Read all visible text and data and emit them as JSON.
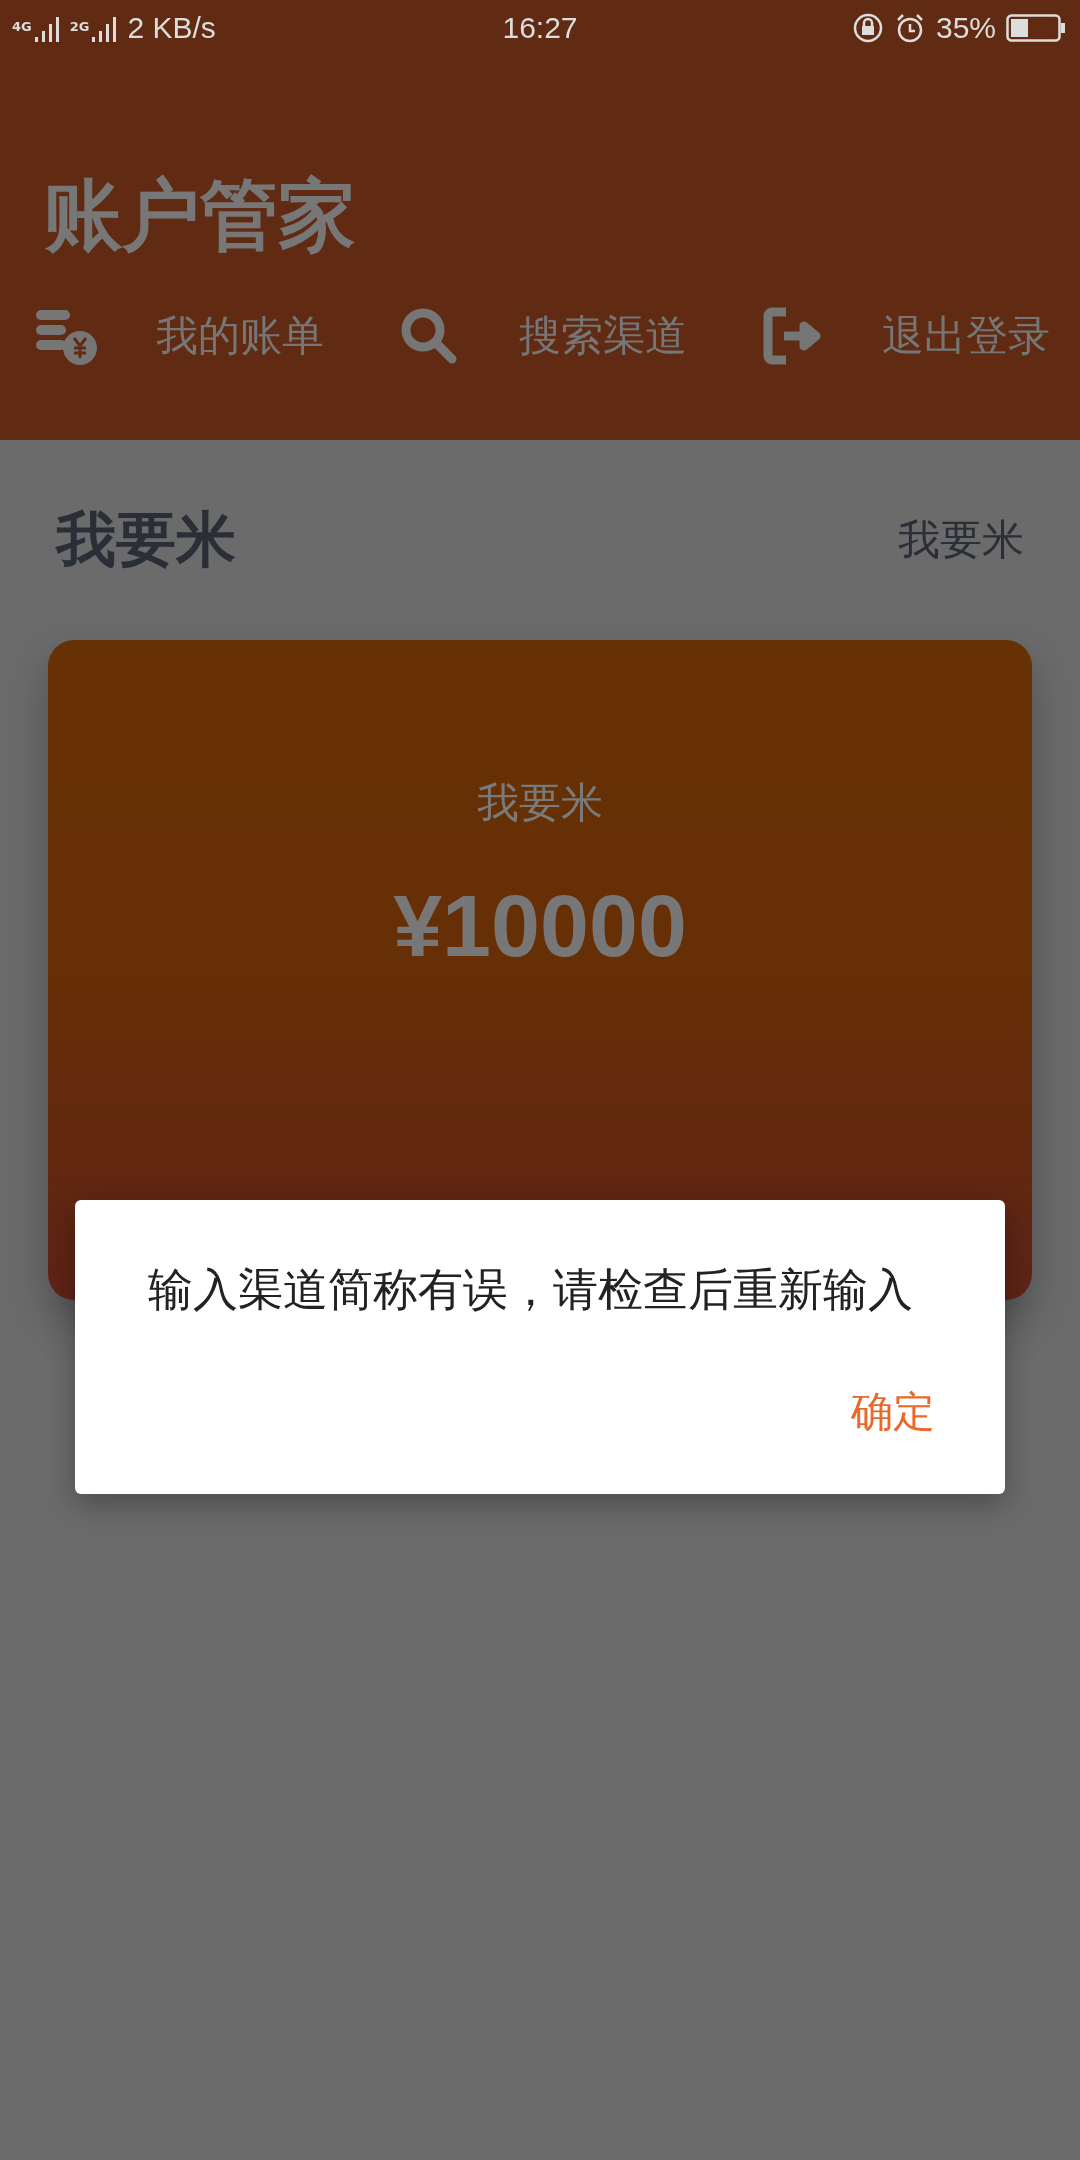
{
  "status_bar": {
    "networks": [
      "4G",
      "2G"
    ],
    "speed": "2 KB/s",
    "time": "16:27",
    "battery": "35%"
  },
  "app_bar": {
    "title": "账户管家",
    "nav": [
      {
        "kind": "bill",
        "label": "我的账单"
      },
      {
        "kind": "search",
        "label": "搜索渠道"
      },
      {
        "kind": "logout",
        "label": "退出登录"
      }
    ]
  },
  "section": {
    "title": "我要米",
    "action": "我要米"
  },
  "card": {
    "label": "我要米",
    "amount": "¥10000"
  },
  "dialog": {
    "message": "输入渠道简称有误，请检查后重新输入",
    "buttons": [
      "确定"
    ]
  }
}
